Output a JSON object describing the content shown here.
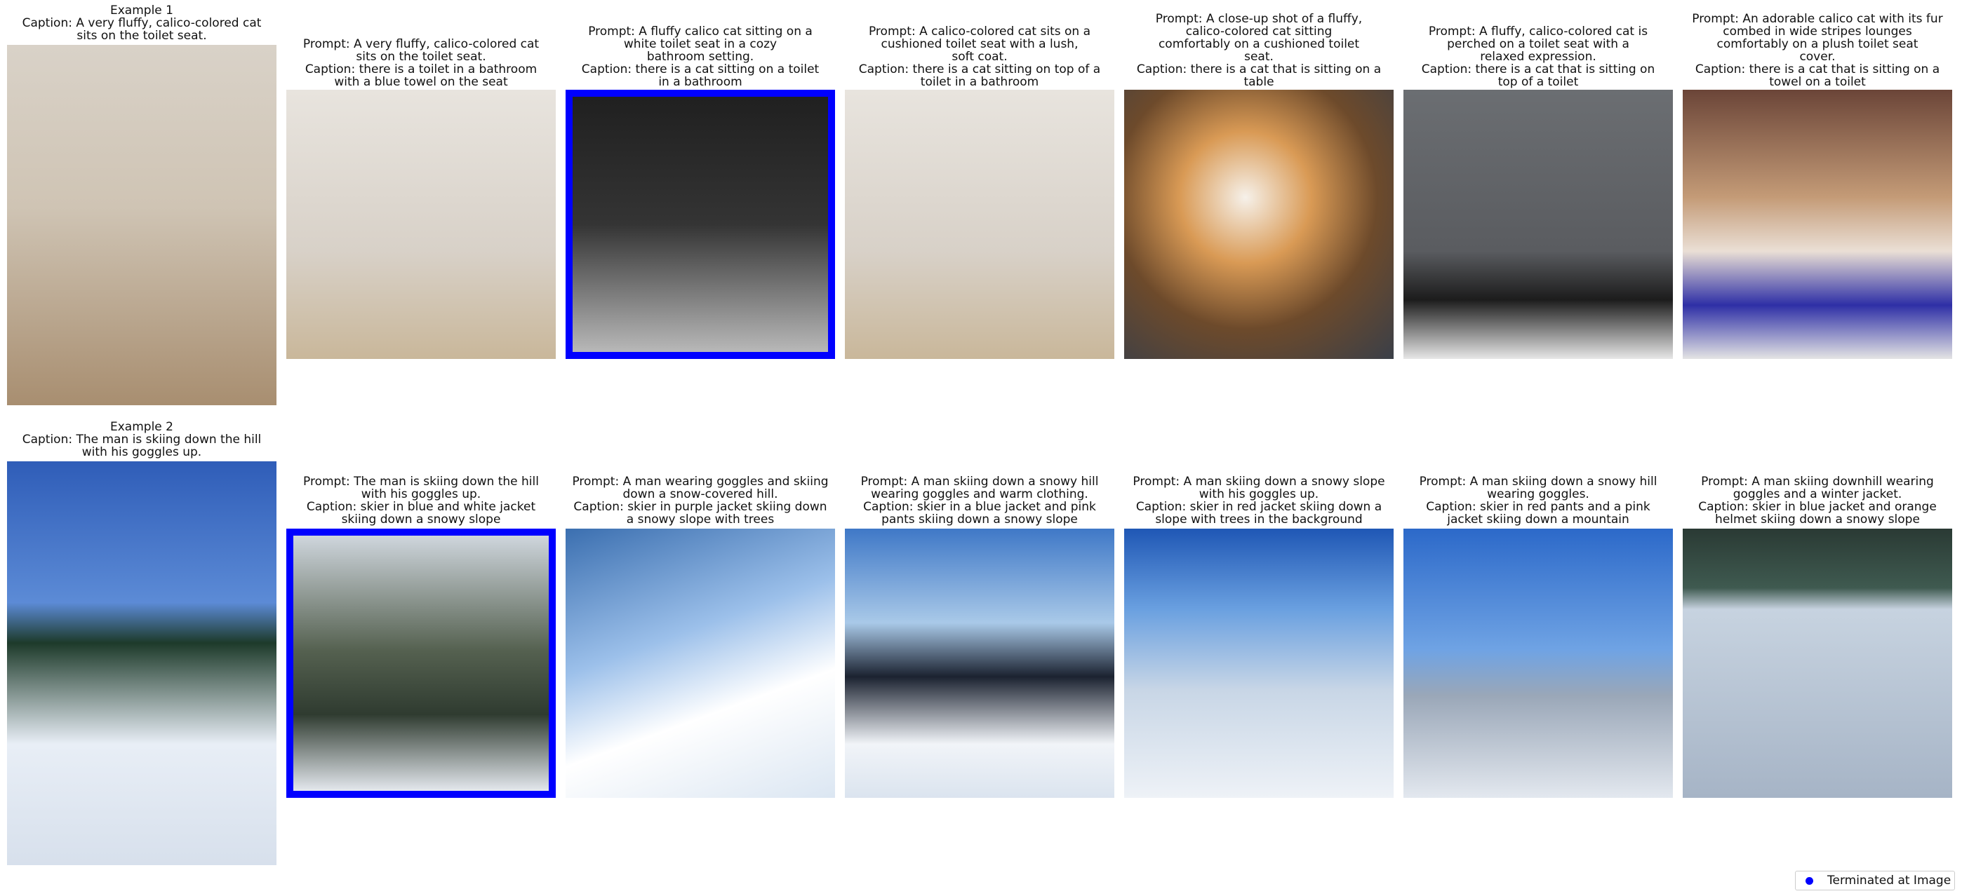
{
  "legend": {
    "label": "Terminated at Image",
    "color": "#0000ff"
  },
  "rows": [
    {
      "example_caption": "Example 1\nCaption: A very fluffy, calico-colored cat\nsits on the toilet seat.",
      "images": [
        {
          "text": "Prompt: A very fluffy, calico-colored cat\nsits on the toilet seat.\nCaption: there is a toilet in a bathroom\nwith a blue towel on the seat",
          "terminated": false
        },
        {
          "text": "Prompt: A fluffy calico cat sitting on a\nwhite toilet seat in a cozy\nbathroom setting.\nCaption: there is a cat sitting on a toilet\nin a bathroom",
          "terminated": true
        },
        {
          "text": "Prompt: A calico-colored cat sits on a\ncushioned toilet seat with a lush,\nsoft coat.\nCaption: there is a cat sitting on top of a\ntoilet in a bathroom",
          "terminated": false
        },
        {
          "text": "Prompt: A close-up shot of a fluffy,\ncalico-colored cat sitting\ncomfortably on a cushioned toilet\nseat.\nCaption: there is a cat that is sitting on a\ntable",
          "terminated": false
        },
        {
          "text": "Prompt: A fluffy, calico-colored cat is\nperched on a toilet seat with a\nrelaxed expression.\nCaption: there is a cat that is sitting on\ntop of a toilet",
          "terminated": false
        },
        {
          "text": "Prompt: An adorable calico cat with its fur\ncombed in wide stripes lounges\ncomfortably on a plush toilet seat\ncover.\nCaption: there is a cat that is sitting on a\ntowel on a toilet",
          "terminated": false
        }
      ]
    },
    {
      "example_caption": "Example 2\nCaption: The man is skiing down the hill\nwith his goggles up.",
      "images": [
        {
          "text": "Prompt: The man is skiing down the hill\nwith his goggles up.\nCaption: skier in blue and white jacket\nskiing down a snowy slope",
          "terminated": true
        },
        {
          "text": "Prompt: A man wearing goggles and skiing\ndown a snow-covered hill.\nCaption: skier in purple jacket skiing down\na snowy slope with trees",
          "terminated": false
        },
        {
          "text": "Prompt: A man skiing down a snowy hill\nwearing goggles and warm clothing.\nCaption: skier in a blue jacket and pink\npants skiing down a snowy slope",
          "terminated": false
        },
        {
          "text": "Prompt: A man skiing down a snowy slope\nwith his goggles up.\nCaption: skier in red jacket skiing down a\nslope with trees in the background",
          "terminated": false
        },
        {
          "text": "Prompt: A man skiing down a snowy hill\nwearing goggles.\nCaption: skier in red pants and a pink\njacket skiing down a mountain",
          "terminated": false
        },
        {
          "text": "Prompt: A man skiing downhill wearing\ngoggles and a winter jacket.\nCaption: skier in blue jacket and orange\nhelmet skiing down a snowy slope",
          "terminated": false
        }
      ]
    }
  ]
}
